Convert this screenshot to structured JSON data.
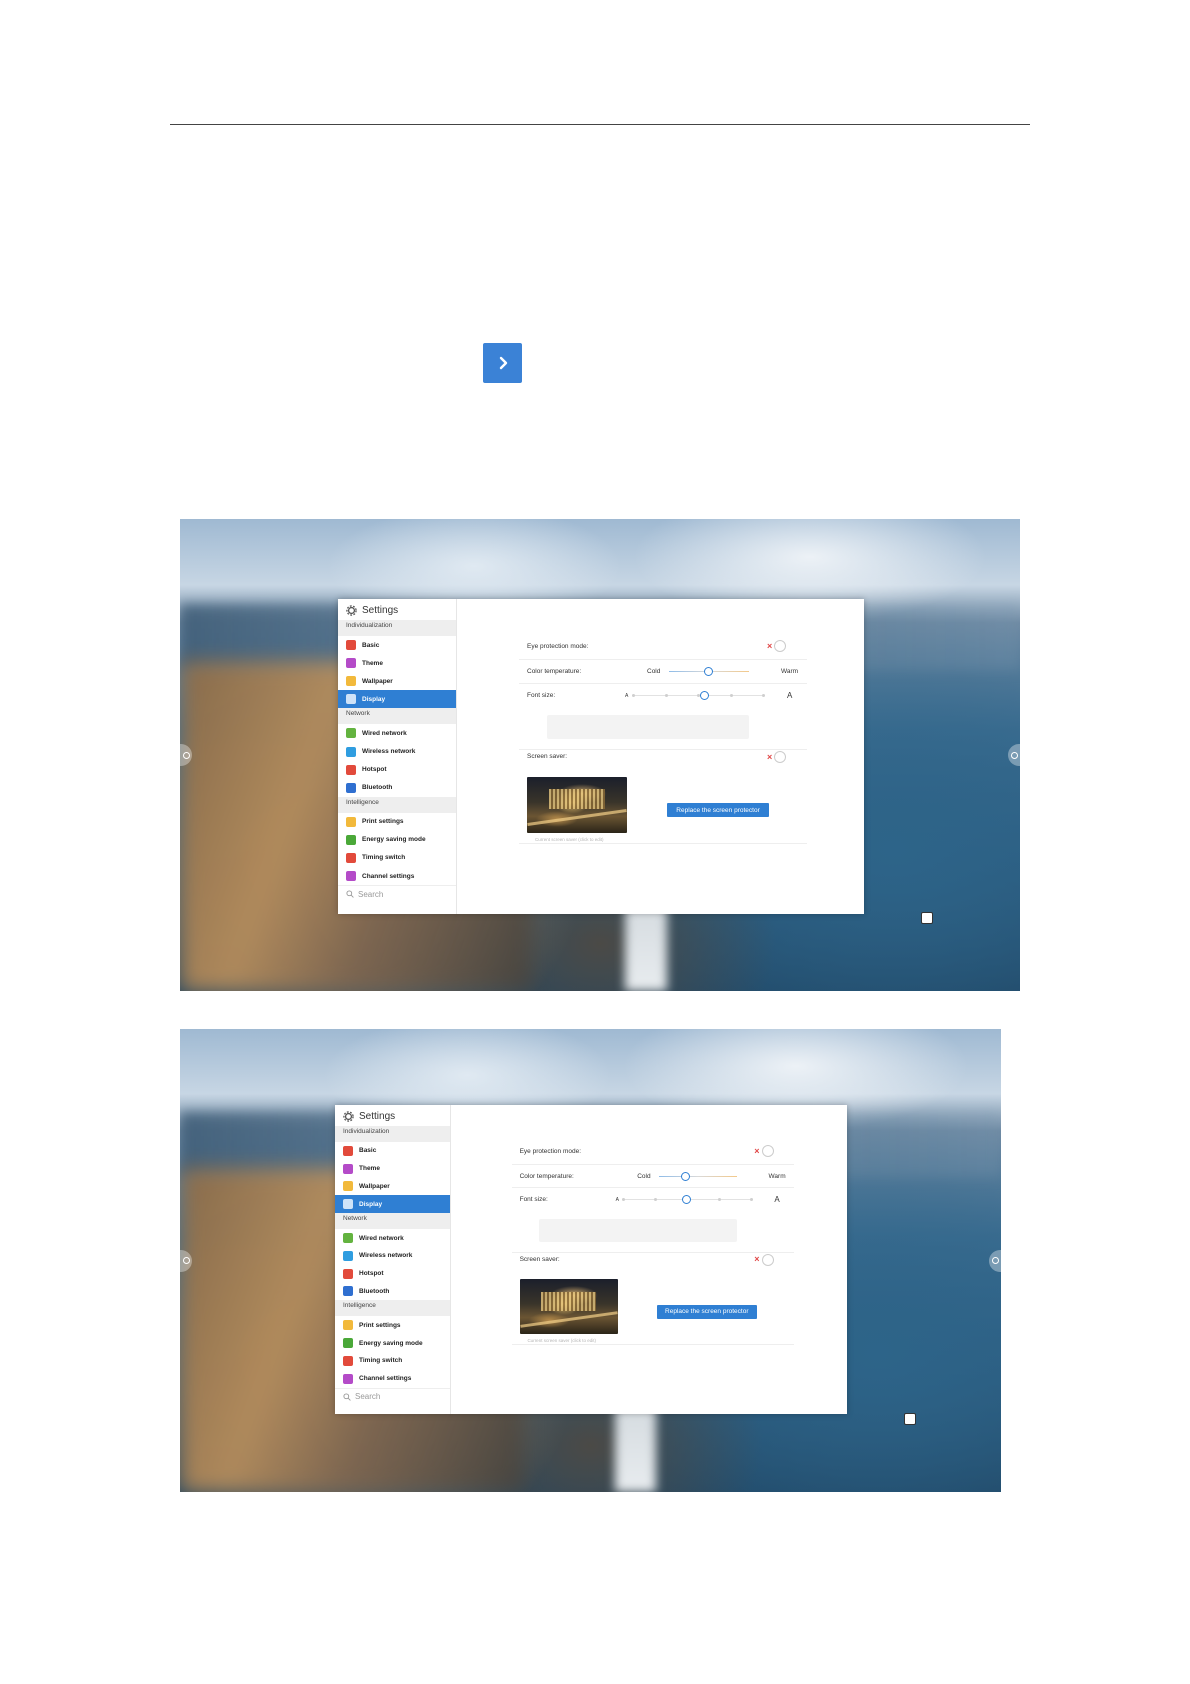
{
  "page": {
    "next_button_icon": "chevron-right-icon",
    "accent_color": "#3b82d6"
  },
  "screens": [
    {
      "window": {
        "title": "Settings",
        "sections": [
          {
            "label": "Individualization",
            "items": [
              {
                "label": "Basic",
                "icon": "basic-icon",
                "color": "#e24a3b"
              },
              {
                "label": "Theme",
                "icon": "theme-icon",
                "color": "#b44bc8"
              },
              {
                "label": "Wallpaper",
                "icon": "wallpaper-icon",
                "color": "#f2b93b"
              },
              {
                "label": "Display",
                "icon": "display-icon",
                "color": "#2f7fd3",
                "active": true
              }
            ]
          },
          {
            "label": "Network",
            "items": [
              {
                "label": "Wired network",
                "icon": "wired-network-icon",
                "color": "#63b33f"
              },
              {
                "label": "Wireless network",
                "icon": "wireless-network-icon",
                "color": "#2f9de0"
              },
              {
                "label": "Hotspot",
                "icon": "hotspot-icon",
                "color": "#e24a3b"
              },
              {
                "label": "Bluetooth",
                "icon": "bluetooth-icon",
                "color": "#2f6fd0"
              }
            ]
          },
          {
            "label": "Intelligence",
            "items": [
              {
                "label": "Print settings",
                "icon": "print-icon",
                "color": "#f2b93b"
              },
              {
                "label": "Energy saving mode",
                "icon": "energy-icon",
                "color": "#4aa838"
              },
              {
                "label": "Timing switch",
                "icon": "timing-icon",
                "color": "#e24a3b"
              },
              {
                "label": "Channel settings",
                "icon": "channel-icon",
                "color": "#b44bc8"
              }
            ]
          }
        ],
        "search_placeholder": "Search",
        "eye_protection_label": "Eye protection mode:",
        "eye_protection_on": false,
        "color_temp_label": "Color temperature:",
        "color_temp_cold": "Cold",
        "color_temp_warm": "Warm",
        "color_temp_level": 0.5,
        "font_size_label": "Font size:",
        "font_small": "A",
        "font_large": "A",
        "font_size_level": 0.55,
        "screen_saver_label": "Screen saver:",
        "screen_saver_on": false,
        "replace_button": "Replace the screen protector",
        "thumb_caption": "Current screen saver (click to edit)"
      }
    },
    {
      "window": {
        "title": "Settings",
        "sections": [
          {
            "label": "Individualization",
            "items": [
              {
                "label": "Basic",
                "icon": "basic-icon",
                "color": "#e24a3b"
              },
              {
                "label": "Theme",
                "icon": "theme-icon",
                "color": "#b44bc8"
              },
              {
                "label": "Wallpaper",
                "icon": "wallpaper-icon",
                "color": "#f2b93b"
              },
              {
                "label": "Display",
                "icon": "display-icon",
                "color": "#2f7fd3",
                "active": true
              }
            ]
          },
          {
            "label": "Network",
            "items": [
              {
                "label": "Wired network",
                "icon": "wired-network-icon",
                "color": "#63b33f"
              },
              {
                "label": "Wireless network",
                "icon": "wireless-network-icon",
                "color": "#2f9de0"
              },
              {
                "label": "Hotspot",
                "icon": "hotspot-icon",
                "color": "#e24a3b"
              },
              {
                "label": "Bluetooth",
                "icon": "bluetooth-icon",
                "color": "#2f6fd0"
              }
            ]
          },
          {
            "label": "Intelligence",
            "items": [
              {
                "label": "Print settings",
                "icon": "print-icon",
                "color": "#f2b93b"
              },
              {
                "label": "Energy saving mode",
                "icon": "energy-icon",
                "color": "#4aa838"
              },
              {
                "label": "Timing switch",
                "icon": "timing-icon",
                "color": "#e24a3b"
              },
              {
                "label": "Channel settings",
                "icon": "channel-icon",
                "color": "#b44bc8"
              }
            ]
          }
        ],
        "search_placeholder": "Search",
        "eye_protection_label": "Eye protection mode:",
        "eye_protection_on": false,
        "color_temp_label": "Color temperature:",
        "color_temp_cold": "Cold",
        "color_temp_warm": "Warm",
        "color_temp_level": 0.35,
        "font_size_label": "Font size:",
        "font_small": "A",
        "font_large": "A",
        "font_size_level": 0.5,
        "screen_saver_label": "Screen saver:",
        "screen_saver_on": false,
        "replace_button": "Replace the screen protector",
        "thumb_caption": "Current screen saver (click to edit)"
      }
    }
  ]
}
